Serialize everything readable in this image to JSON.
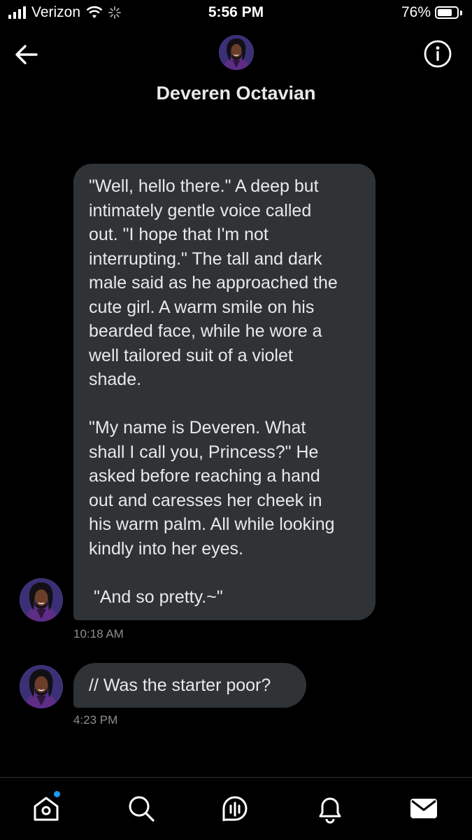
{
  "status_bar": {
    "carrier": "Verizon",
    "time": "5:56 PM",
    "battery": "76%",
    "battery_level": 0.76
  },
  "header": {
    "title": "Deveren Octavian",
    "back_icon": "arrow-left-icon",
    "info_icon": "info-icon"
  },
  "messages": [
    {
      "text": "\"Well, hello there.\" A deep but\nintimately gentle voice called\nout. \"I hope that I'm not\ninterrupting.\" The tall and dark\nmale said as he approached the\ncute girl. A warm smile on his\nbearded face, while he wore a\nwell tailored suit of a violet\nshade.\n\n\"My name is Deveren. What\nshall I call you, Princess?\" He\nasked before reaching a hand\nout and caresses her cheek in\nhis warm palm. All while looking\nkindly into her eyes.\n\n \"And so pretty.~\"",
      "time": "10:18 AM"
    },
    {
      "text": "// Was the starter poor?",
      "time": "4:23 PM"
    }
  ],
  "nav": {
    "items": [
      "home-icon",
      "search-icon",
      "spaces-icon",
      "notifications-icon",
      "messages-icon"
    ]
  },
  "colors": {
    "background": "#000000",
    "bubble": "#2f3336",
    "text": "#e7e9ea",
    "muted": "#8b8f94",
    "accent": "#1d9bf0"
  }
}
